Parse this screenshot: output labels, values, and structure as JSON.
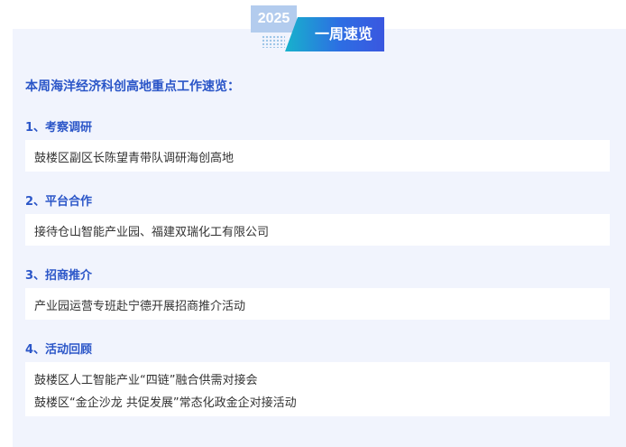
{
  "badge": {
    "year": "2025",
    "title": "一周速览"
  },
  "intro": "本周海洋经济科创高地重点工作速览：",
  "sections": [
    {
      "heading": "1、考察调研",
      "items": [
        "鼓楼区副区长陈望青带队调研海创高地"
      ]
    },
    {
      "heading": "2、平台合作",
      "items": [
        "接待仓山智能产业园、福建双瑞化工有限公司"
      ]
    },
    {
      "heading": "3、招商推介",
      "items": [
        "产业园运营专班赴宁德开展招商推介活动"
      ]
    },
    {
      "heading": "4、活动回顾",
      "items": [
        "鼓楼区人工智能产业“四链”融合供需对接会",
        "鼓楼区“金企沙龙 共促发展”常态化政金企对接活动"
      ]
    }
  ],
  "colors": {
    "panel_bg": "#f1f4fd",
    "heading": "#2b56c8",
    "text": "#333333",
    "year_bg": "#b3ccee"
  }
}
